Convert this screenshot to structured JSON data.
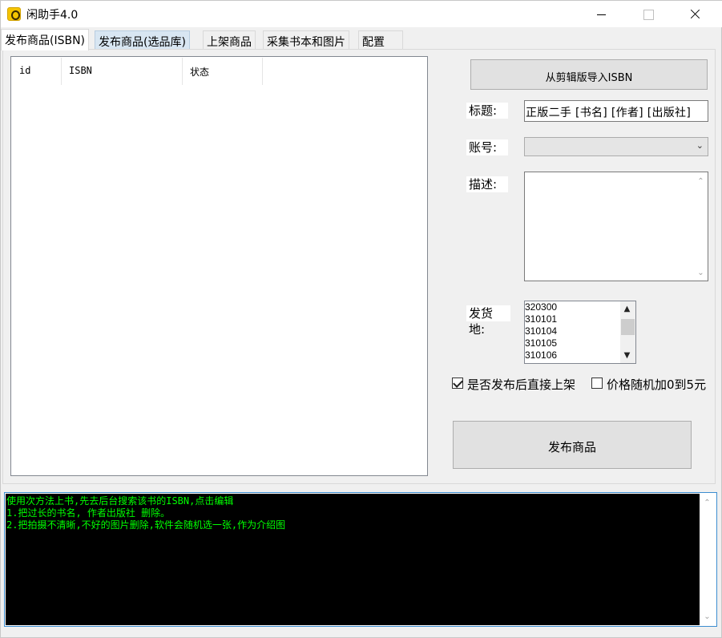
{
  "window": {
    "title": "闲助手4.0",
    "controls": [
      "minimize",
      "maximize",
      "close"
    ]
  },
  "tabs": [
    {
      "label": "发布商品(ISBN)",
      "active": true
    },
    {
      "label": "发布商品(选品库)",
      "active": false
    },
    {
      "label": "上架商品",
      "active": false
    },
    {
      "label": "采集书本和图片",
      "active": false
    },
    {
      "label": "配置",
      "active": false
    }
  ],
  "list": {
    "columns": [
      "id",
      "ISBN",
      "状态"
    ],
    "rows": []
  },
  "form": {
    "import_button": "从剪辑版导入ISBN",
    "title_label": "标题:",
    "title_value": "正版二手 [书名] [作者] [出版社]",
    "account_label": "账号:",
    "account_value": "",
    "desc_label": "描述:",
    "desc_value": "",
    "ship_label": "发货地:",
    "ship_options": [
      "320300",
      "310101",
      "310104",
      "310105",
      "310106"
    ],
    "auto_list_checked": true,
    "auto_list_label": "是否发布后直接上架",
    "random_price_checked": false,
    "random_price_label": "价格随机加0到5元",
    "publish_button": "发布商品"
  },
  "console": {
    "lines": [
      "使用次方法上书,先去后台搜索该书的ISBN,点击编辑",
      "1.把过长的书名, 作者出版社 删除。",
      "2.把拍摄不清晰,不好的图片删除,软件会随机选一张,作为介绍图"
    ],
    "text_color": "#00ff00",
    "background": "#000000"
  }
}
